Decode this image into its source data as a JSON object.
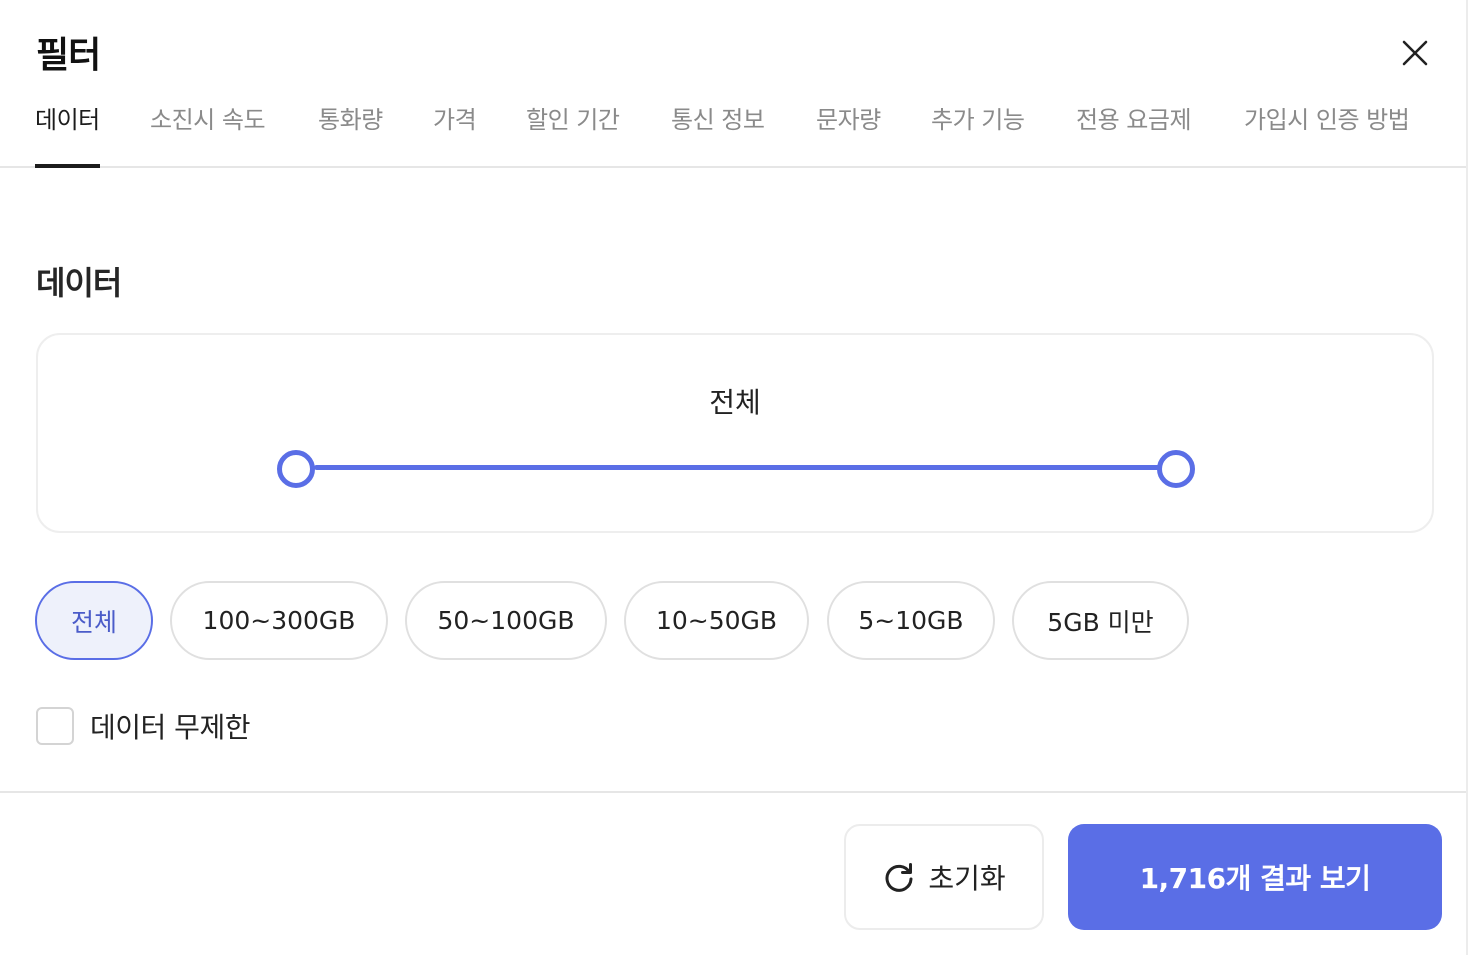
{
  "header": {
    "title": "필터",
    "close_icon": "close-icon"
  },
  "tabs": [
    {
      "label": "데이터",
      "active": true
    },
    {
      "label": "소진시 속도",
      "active": false
    },
    {
      "label": "통화량",
      "active": false
    },
    {
      "label": "가격",
      "active": false
    },
    {
      "label": "할인 기간",
      "active": false
    },
    {
      "label": "통신 정보",
      "active": false
    },
    {
      "label": "문자량",
      "active": false
    },
    {
      "label": "추가 기능",
      "active": false
    },
    {
      "label": "전용 요금제",
      "active": false
    },
    {
      "label": "가입시 인증 방법",
      "active": false
    }
  ],
  "data_section": {
    "title": "데이터",
    "range": {
      "label": "전체",
      "min_fraction": 0,
      "max_fraction": 1
    },
    "chips": [
      {
        "label": "전체",
        "selected": true
      },
      {
        "label": "100~300GB",
        "selected": false
      },
      {
        "label": "50~100GB",
        "selected": false
      },
      {
        "label": "10~50GB",
        "selected": false
      },
      {
        "label": "5~10GB",
        "selected": false
      },
      {
        "label": "5GB 미만",
        "selected": false
      }
    ],
    "unlimited": {
      "label": "데이터 무제한",
      "checked": false
    }
  },
  "footer": {
    "reset_label": "초기화",
    "reset_icon": "refresh-icon",
    "apply_label": "1,716개 결과 보기"
  },
  "colors": {
    "accent": "#5a6ee6",
    "selected_chip_bg": "#eef1fb",
    "text": "#1f1f1f",
    "muted_text": "#8a8a8a",
    "border": "#e6e6e6"
  }
}
